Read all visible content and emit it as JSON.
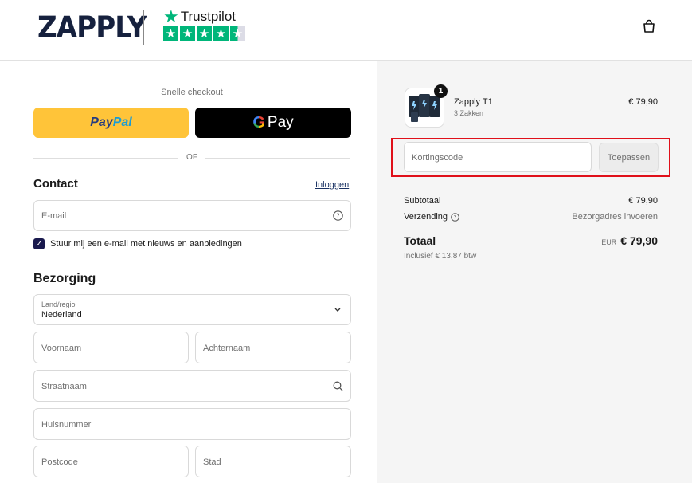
{
  "header": {
    "logo_text": "ZAPPLY",
    "trustpilot_label": "Trustpilot",
    "trustpilot_stars": 4.5,
    "bag_icon": "shopping-bag-icon"
  },
  "express": {
    "label": "Snelle checkout",
    "paypal_a": "Pay",
    "paypal_b": "Pal",
    "gpay_label": "Pay",
    "or": "OF"
  },
  "contact": {
    "title": "Contact",
    "login": "Inloggen",
    "email_placeholder": "E-mail",
    "newsletter": "Stuur mij een e-mail met nieuws en aanbiedingen",
    "newsletter_checked": true
  },
  "delivery": {
    "title": "Bezorging",
    "country_label": "Land/regio",
    "country_value": "Nederland",
    "first_name": "Voornaam",
    "last_name": "Achternaam",
    "street": "Straatnaam",
    "house_number": "Huisnummer",
    "postcode": "Postcode",
    "city": "Stad"
  },
  "summary": {
    "item": {
      "name": "Zapply T1",
      "variant": "3 Zakken",
      "price": "€ 79,90",
      "quantity": "1"
    },
    "discount_placeholder": "Kortingscode",
    "apply": "Toepassen",
    "subtotal_label": "Subtotaal",
    "subtotal_value": "€ 79,90",
    "shipping_label": "Verzending",
    "shipping_value": "Bezorgadres invoeren",
    "total_label": "Totaal",
    "total_currency": "EUR",
    "total_value": "€ 79,90",
    "tax_note": "Inclusief € 13,87 btw",
    "highlight_color": "#e0101a"
  }
}
